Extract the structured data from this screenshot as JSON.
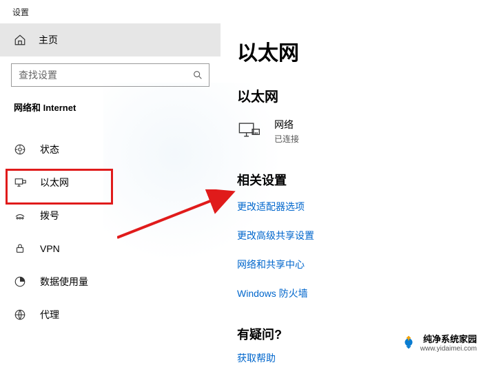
{
  "header": {
    "title": "设置"
  },
  "sidebar": {
    "home_label": "主页",
    "search_placeholder": "查找设置",
    "section_title": "网络和 Internet",
    "items": [
      {
        "label": "状态"
      },
      {
        "label": "以太网"
      },
      {
        "label": "拨号"
      },
      {
        "label": "VPN"
      },
      {
        "label": "数据使用量"
      },
      {
        "label": "代理"
      }
    ]
  },
  "main": {
    "page_title": "以太网",
    "net_heading": "以太网",
    "network": {
      "name": "网络",
      "status": "已连接"
    },
    "related": {
      "heading": "相关设置",
      "links": [
        "更改适配器选项",
        "更改高级共享设置",
        "网络和共享中心",
        "Windows 防火墙"
      ]
    },
    "question": {
      "heading": "有疑问?",
      "link": "获取帮助"
    }
  },
  "watermark": {
    "line1": "纯净系统家园",
    "line2": "www.yidaimei.com"
  }
}
